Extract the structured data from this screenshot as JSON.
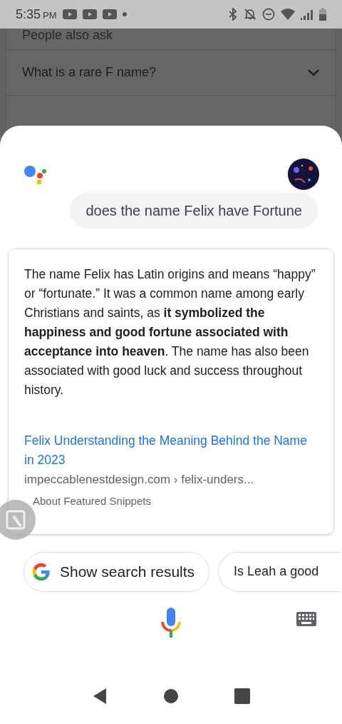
{
  "status_bar": {
    "time": "5:35",
    "ampm": "PM"
  },
  "background": {
    "heading": "People also ask",
    "questions": [
      {
        "text": "What is a rare F name?",
        "expanded": false
      }
    ]
  },
  "query": "does the name Felix have Fortune",
  "answer": {
    "text": "The name Felix has Latin origins and means “happy” or “fortunate.” It was a common name among early Christians and saints, as **it symbolized the happiness and good fortune associated with acceptance into heaven**. The name has also been associated with good luck and success throughout history.",
    "link_title": "Felix Understanding the Meaning Behind the Name in 2023",
    "source": "impeccablenestdesign.com › felix-unders...",
    "about": "About Featured Snippets"
  },
  "chips": [
    {
      "kind": "search",
      "label": "Show search results"
    },
    {
      "kind": "suggestion",
      "label": "Is Leah a good"
    }
  ]
}
